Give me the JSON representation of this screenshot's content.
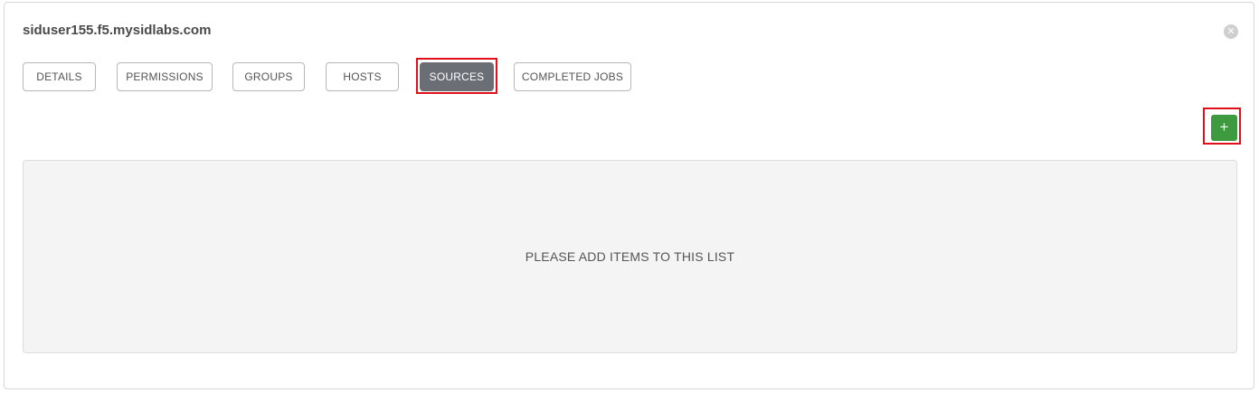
{
  "panel": {
    "title": "siduser155.f5.mysidlabs.com",
    "close_icon": "close-circle-icon"
  },
  "tabs": [
    {
      "label": "DETAILS",
      "active": false
    },
    {
      "label": "PERMISSIONS",
      "active": false
    },
    {
      "label": "GROUPS",
      "active": false
    },
    {
      "label": "HOSTS",
      "active": false
    },
    {
      "label": "SOURCES",
      "active": true
    },
    {
      "label": "COMPLETED JOBS",
      "active": false
    }
  ],
  "toolbar": {
    "add_label": "+"
  },
  "list": {
    "empty_message": "PLEASE ADD ITEMS TO THIS LIST"
  },
  "colors": {
    "active_tab": "#6b6f75",
    "add_button": "#3d9a3e",
    "highlight": "#e0101a"
  }
}
